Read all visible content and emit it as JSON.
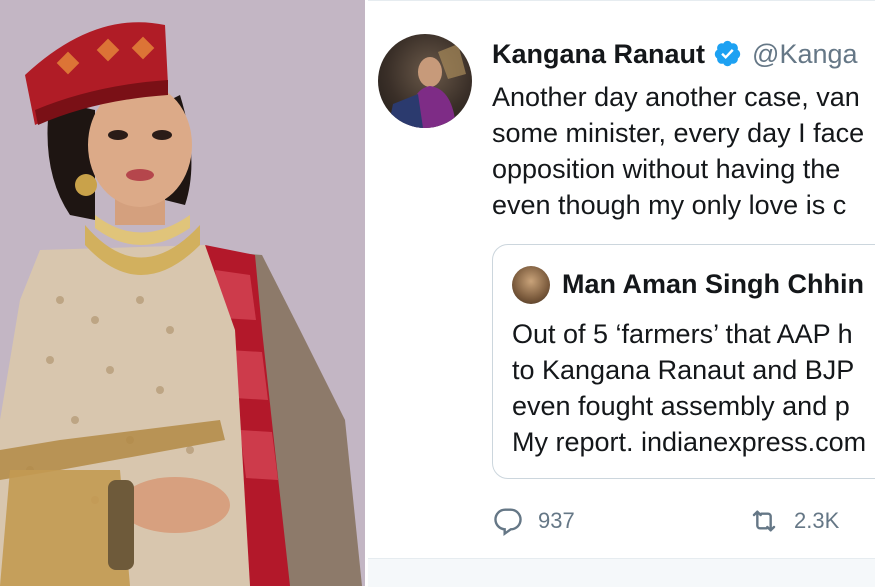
{
  "tweet": {
    "display_name": "Kangana Ranaut",
    "handle": "@Kanga",
    "text_lines": [
      "Another day another case, van",
      "some minister, every day I face",
      "opposition without having the",
      "even though my only love is c"
    ],
    "quoted": {
      "display_name": "Man Aman Singh Chhin",
      "text_lines": [
        "Out of 5 ‘farmers’ that AAP h",
        "to Kangana Ranaut and BJP",
        "even fought assembly and p",
        "My report. indianexpress.com"
      ]
    },
    "actions": {
      "reply_count": "937",
      "retweet_count": "2.3K"
    }
  },
  "colors": {
    "verified_blue": "#1da1f2",
    "text_primary": "#14171a",
    "text_secondary": "#657786",
    "card_border": "#ccd6dd"
  },
  "icons": {
    "verified": "verified-badge-icon",
    "reply": "reply-icon",
    "retweet": "retweet-icon"
  }
}
